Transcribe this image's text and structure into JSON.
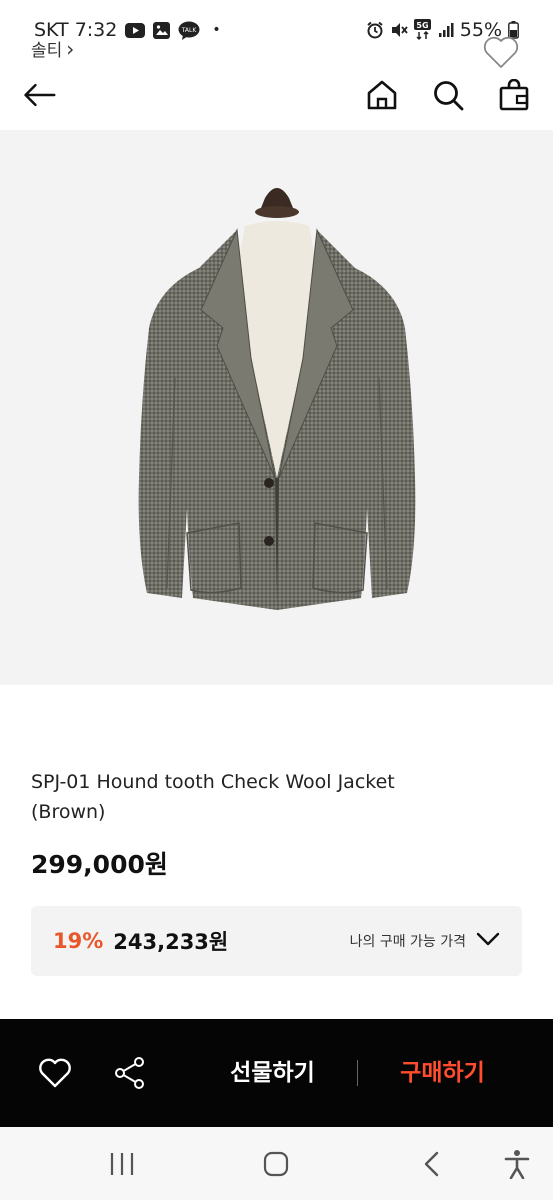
{
  "status_bar": {
    "carrier_time": "SKT 7:32",
    "battery": "55%",
    "icons_left": [
      "youtube-icon",
      "gallery-icon",
      "talk-icon",
      "dot-icon"
    ],
    "icons_right": [
      "alarm-icon",
      "mute-icon",
      "5g-icon",
      "signal-icon",
      "battery-icon"
    ],
    "network_label": "5G",
    "talk_label": "TALK",
    "dot": "•"
  },
  "header": {
    "icons": [
      "back-arrow-icon",
      "home-icon",
      "search-icon",
      "shopping-bag-icon"
    ]
  },
  "product": {
    "brand": "솔티",
    "brand_chevron": "›",
    "name": "SPJ-01 Hound tooth Check Wool Jacket (Brown)",
    "price": "299,000원",
    "image_icon": "jacket-image"
  },
  "my_price": {
    "discount": "19%",
    "discounted_price": "243,233원",
    "label": "나의 구매 가능 가격"
  },
  "action_bar": {
    "gift_label": "선물하기",
    "buy_label": "구매하기",
    "accent_color": "#ff4d2e"
  },
  "nav_bar": {
    "icons": [
      "recents-icon",
      "home-circle-icon",
      "back-chevron-icon",
      "accessibility-icon"
    ]
  },
  "colors": {
    "discount": "#e8572a",
    "action_bar_bg": "#050505",
    "image_bg": "#f3f3f3"
  }
}
